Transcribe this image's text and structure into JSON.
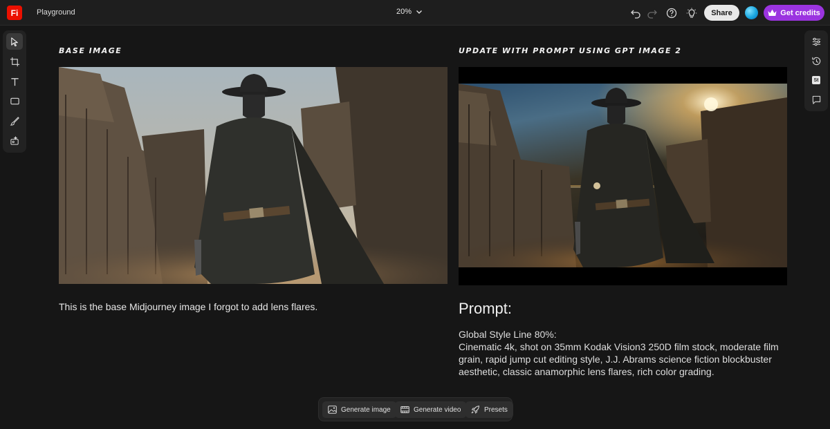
{
  "app": {
    "logo_text": "Fi",
    "logo_color": "#eb1000",
    "title": "Playground"
  },
  "toolbar": {
    "zoom": "20%",
    "share_label": "Share",
    "credits_label": "Get credits",
    "credits_color": "#9b34e0",
    "icons": [
      "undo-icon",
      "redo-icon",
      "help-icon",
      "lightbulb-icon"
    ]
  },
  "left_tools": [
    "select-icon",
    "crop-icon",
    "text-icon",
    "shape-icon",
    "brush-icon",
    "generate-icon"
  ],
  "right_tools": [
    "adjustments-icon",
    "history-icon",
    "stock-icon",
    "comment-icon"
  ],
  "right_tools_stock_label": "St",
  "left_panel": {
    "heading": "Base Image",
    "caption": "This is the base Midjourney image I forgot to add lens flares."
  },
  "right_panel": {
    "heading": "Update with prompt  using GPT Image 2",
    "prompt_title": "Prompt:",
    "prompt_line1": "Global Style Line 80%:",
    "prompt_body": "Cinematic 4k, shot on 35mm Kodak Vision3 250D film stock, moderate film grain, rapid jump cut editing style, J.J. Abrams science fiction blockbuster aesthetic, classic anamorphic lens flares, rich color grading."
  },
  "dock": {
    "generate_image": "Generate image",
    "generate_video": "Generate video",
    "presets": "Presets"
  }
}
